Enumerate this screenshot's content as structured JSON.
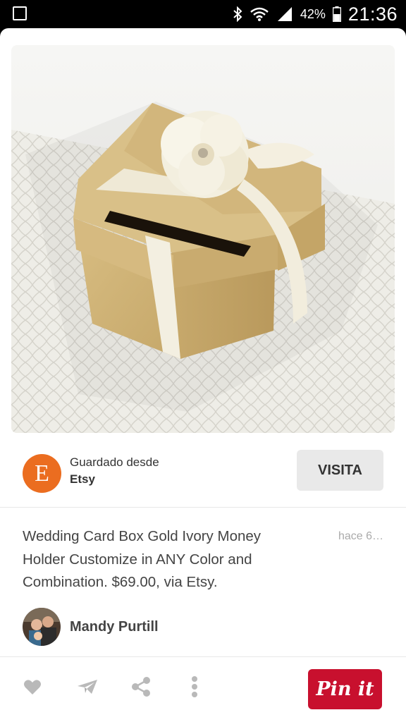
{
  "status_bar": {
    "battery_pct": "42%",
    "time": "21:36"
  },
  "source": {
    "saved_from_label": "Guardado desde",
    "site_name": "Etsy",
    "logo_letter": "E",
    "visit_label": "VISITA"
  },
  "pin": {
    "description": "Wedding Card Box Gold Ivory Money Holder Customize in ANY Color and Combination. $69.00, via Etsy.",
    "time_ago": "hace 6…"
  },
  "pinner": {
    "name": "Mandy Purtill"
  },
  "actions": {
    "pin_it_label": "Pin it",
    "icons": [
      "heart-icon",
      "send-icon",
      "share-icon",
      "more-icon"
    ]
  },
  "colors": {
    "etsy_orange": "#eb6d20",
    "pinterest_red": "#c8102e"
  }
}
